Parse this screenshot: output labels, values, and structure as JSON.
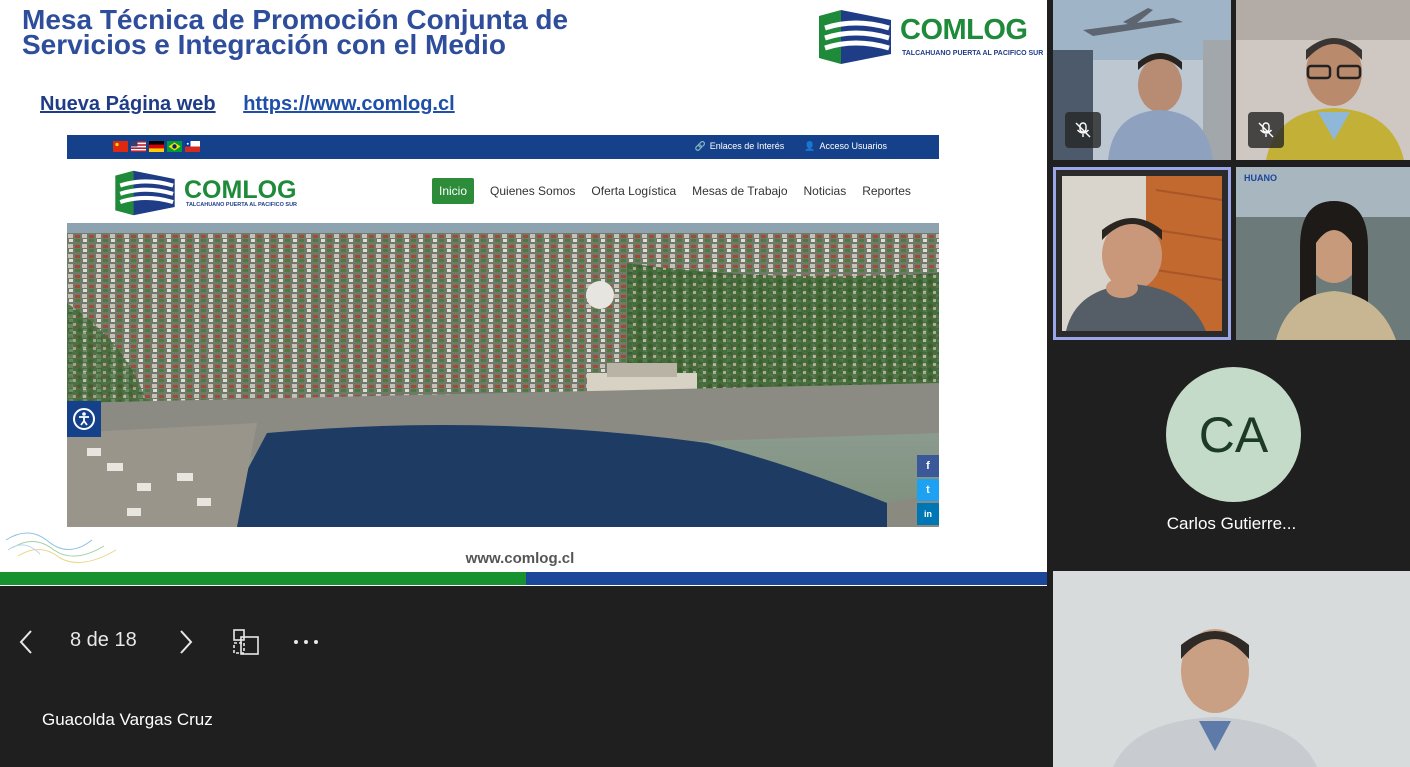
{
  "slide": {
    "title_line1": "Mesa Técnica de Promoción Conjunta de",
    "title_line2": "Servicios e Integración con el Medio",
    "logo_word": "COMLOG",
    "logo_tagline": "TALCAHUANO PUERTA AL PACIFICO SUR",
    "link_label": "Nueva Página web",
    "link_url": "https://www.comlog.cl",
    "footer_url": "www.comlog.cl"
  },
  "website": {
    "top_links": [
      "Enlaces de Interés",
      "Acceso Usuarios"
    ],
    "logo_word": "COMLOG",
    "logo_tagline": "TALCAHUANO PUERTA AL PACIFICO SUR",
    "nav": [
      "Inicio",
      "Quienes Somos",
      "Oferta Logística",
      "Mesas de Trabajo",
      "Noticias",
      "Reportes"
    ],
    "social": [
      "f",
      "t",
      "in"
    ]
  },
  "controls": {
    "page_indicator": "8 de 18"
  },
  "presenter_name": "Guacolda Vargas Cruz",
  "participants": {
    "avatar_initials": "CA",
    "avatar_name": "Carlos Gutierre..."
  },
  "colors": {
    "title_blue": "#2e4d9b",
    "brand_green": "#1f8a3a",
    "brand_blue": "#1b4699",
    "active_speaker": "#9aa6e8",
    "avatar_bg": "#c5dbc9"
  }
}
